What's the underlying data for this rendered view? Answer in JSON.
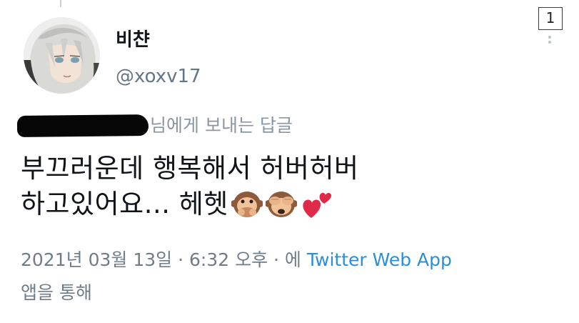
{
  "page_badge": "1",
  "user": {
    "display_name": "비챤",
    "handle": "@xoxv17"
  },
  "reply": {
    "suffix": "님에게 보내는 답글"
  },
  "tweet": {
    "line1": "부끄러운데 행복해서 허버허버",
    "line2": "하고있어요... 헤헷"
  },
  "meta": {
    "timestamp": "2021년 03월 13일 · 6:32 오후 · 에",
    "source": "Twitter Web App",
    "suffix": "앱을 통해"
  },
  "icons": {
    "avatar": "anime-avatar",
    "emoji1": "speak-no-evil-monkey",
    "emoji2": "see-no-evil-monkey",
    "emoji3": "two-hearts"
  },
  "colors": {
    "link": "#2b8fd8",
    "muted": "#6f7d89",
    "text": "#101419"
  }
}
